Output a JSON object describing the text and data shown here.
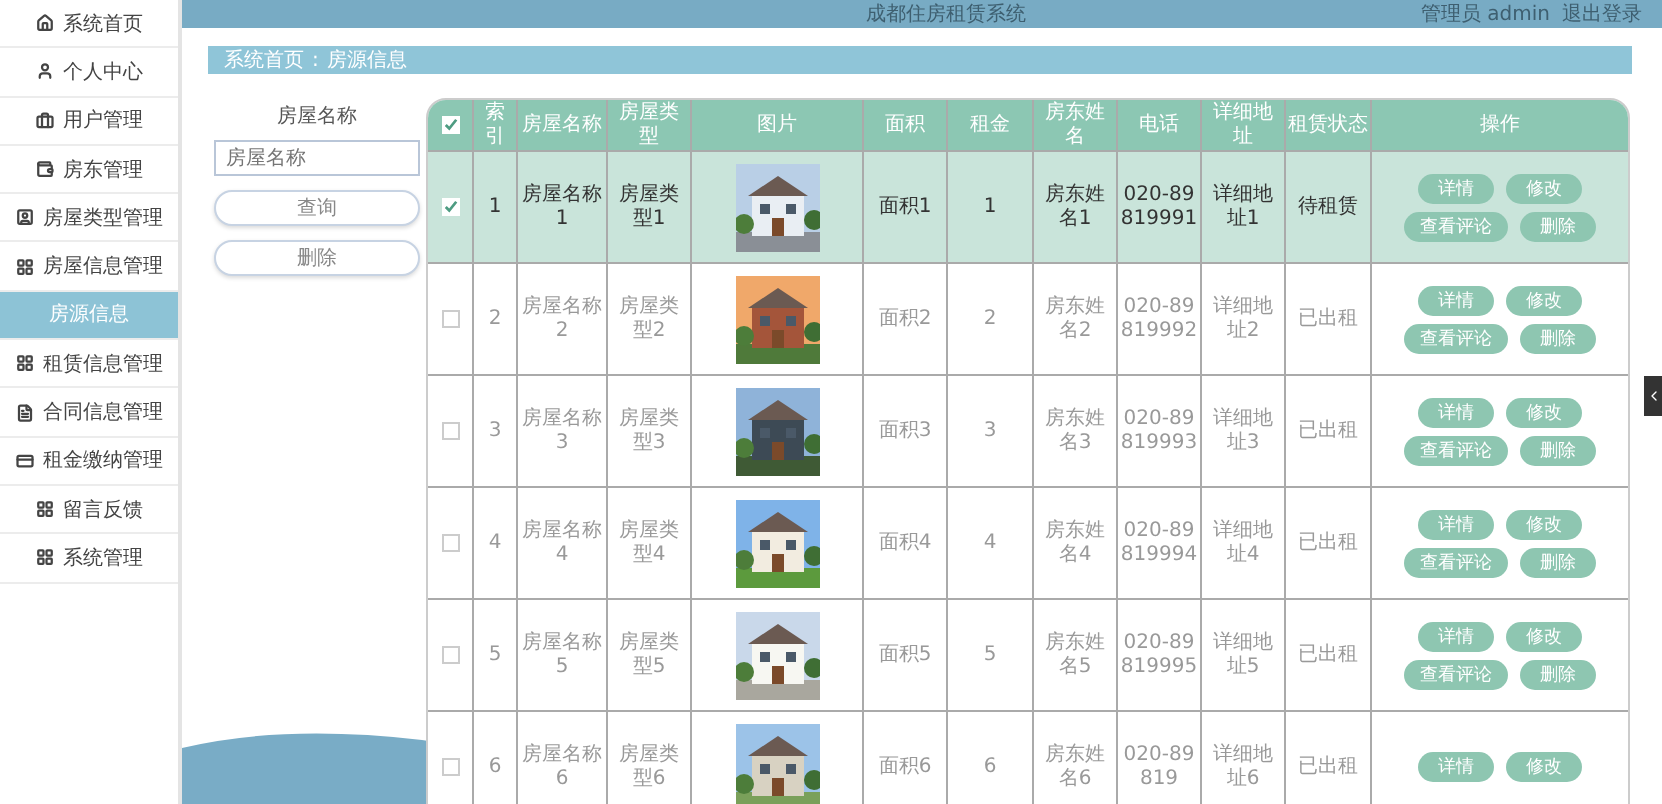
{
  "header": {
    "title": "成都住房租赁系统",
    "user": "管理员 admin",
    "logout": "退出登录"
  },
  "sidebar": {
    "items": [
      {
        "label": "系统首页",
        "selected": false
      },
      {
        "label": "个人中心",
        "selected": false
      },
      {
        "label": "用户管理",
        "selected": false
      },
      {
        "label": "房东管理",
        "selected": false
      },
      {
        "label": "房屋类型管理",
        "selected": false
      },
      {
        "label": "房屋信息管理",
        "selected": false
      },
      {
        "label": "房源信息",
        "selected": true
      },
      {
        "label": "租赁信息管理",
        "selected": false
      },
      {
        "label": "合同信息管理",
        "selected": false
      },
      {
        "label": "租金缴纳管理",
        "selected": false
      },
      {
        "label": "留言反馈",
        "selected": false
      },
      {
        "label": "系统管理",
        "selected": false
      }
    ]
  },
  "breadcrumb": [
    "系统首页",
    "房源信息"
  ],
  "breadcrumb_separator": ":",
  "search": {
    "label": "房屋名称",
    "placeholder": "房屋名称",
    "buttons": [
      "查询",
      "删除"
    ]
  },
  "table": {
    "select_all_checked": true,
    "columns": [
      "索引",
      "房屋名称",
      "房屋类型",
      "图片",
      "面积",
      "租金",
      "房东姓名",
      "电话",
      "详细地址",
      "租赁状态",
      "操作"
    ],
    "rows": [
      {
        "selected": true,
        "index": "1",
        "name": "房屋名称1",
        "type": "房屋类型1",
        "area": "面积1",
        "rent": "1",
        "owner": "房东姓名1",
        "phone": "020-89819991",
        "address": "详细地址1",
        "status": "待租赁",
        "actions": [
          "详情",
          "修改",
          "查看评论",
          "删除"
        ]
      },
      {
        "selected": false,
        "index": "2",
        "name": "房屋名称2",
        "type": "房屋类型2",
        "area": "面积2",
        "rent": "2",
        "owner": "房东姓名2",
        "phone": "020-89819992",
        "address": "详细地址2",
        "status": "已出租",
        "actions": [
          "详情",
          "修改",
          "查看评论",
          "删除"
        ]
      },
      {
        "selected": false,
        "index": "3",
        "name": "房屋名称3",
        "type": "房屋类型3",
        "area": "面积3",
        "rent": "3",
        "owner": "房东姓名3",
        "phone": "020-89819993",
        "address": "详细地址3",
        "status": "已出租",
        "actions": [
          "详情",
          "修改",
          "查看评论",
          "删除"
        ]
      },
      {
        "selected": false,
        "index": "4",
        "name": "房屋名称4",
        "type": "房屋类型4",
        "area": "面积4",
        "rent": "4",
        "owner": "房东姓名4",
        "phone": "020-89819994",
        "address": "详细地址4",
        "status": "已出租",
        "actions": [
          "详情",
          "修改",
          "查看评论",
          "删除"
        ]
      },
      {
        "selected": false,
        "index": "5",
        "name": "房屋名称5",
        "type": "房屋类型5",
        "area": "面积5",
        "rent": "5",
        "owner": "房东姓名5",
        "phone": "020-89819995",
        "address": "详细地址5",
        "status": "已出租",
        "actions": [
          "详情",
          "修改",
          "查看评论",
          "删除"
        ]
      },
      {
        "selected": false,
        "index": "6",
        "name": "房屋名称6",
        "type": "房屋类型6",
        "area": "面积6",
        "rent": "6",
        "owner": "房东姓名6",
        "phone": "020-89819",
        "address": "详细地址6",
        "status": "已出租",
        "actions": [
          "详情",
          "修改"
        ]
      }
    ]
  }
}
